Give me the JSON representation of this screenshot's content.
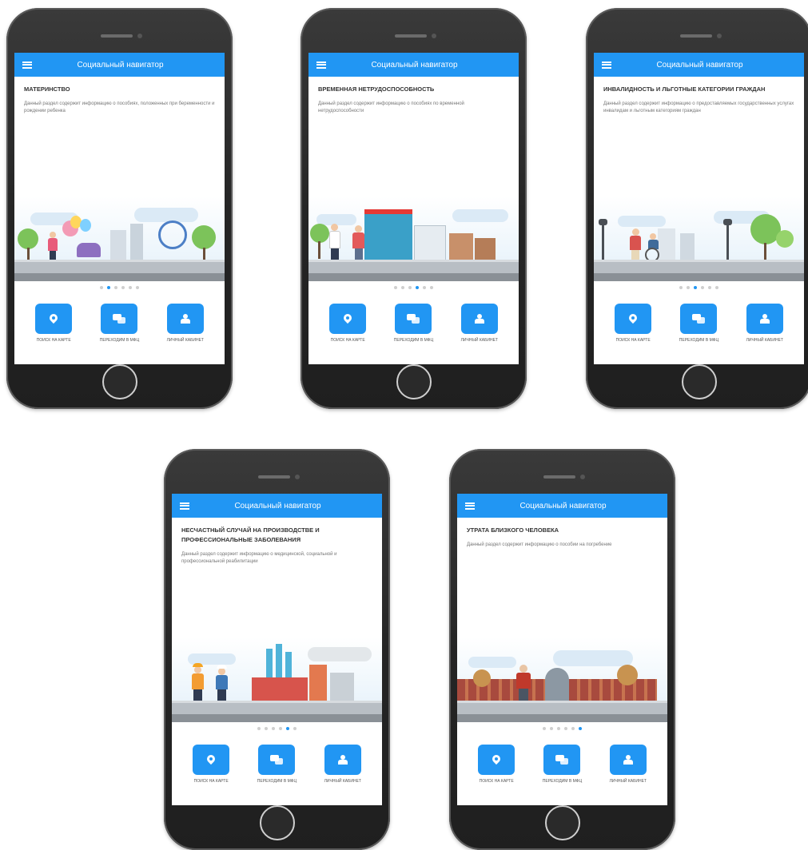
{
  "app": {
    "title": "Социальный навигатор"
  },
  "actions": [
    {
      "label": "Поиск на карте",
      "icon": "map-pin-icon"
    },
    {
      "label": "Переходим в МФЦ",
      "icon": "chat-icon"
    },
    {
      "label": "Личный кабинет",
      "icon": "user-icon"
    }
  ],
  "accent_color": "#2196f3",
  "phones": [
    {
      "title": "Материнство",
      "description": "Данный раздел содержит информацию о пособиях, положенных при беременности и рождении ребенка",
      "active_dot": 1,
      "dot_count": 6
    },
    {
      "title": "Временная нетрудоспособность",
      "description": "Данный раздел содержит информацию о пособиях по временной нетрудоспособности",
      "active_dot": 3,
      "dot_count": 6
    },
    {
      "title": "Инвалидность и льготные категории граждан",
      "description": "Данный раздел содержит информацию о предоставляемых государственных услугах инвалидам и льготным категориям граждан",
      "active_dot": 2,
      "dot_count": 6
    },
    {
      "title": "Несчастный случай на производстве и профессиональные заболевания",
      "description": "Данный раздел содержит информацию о медицинской, социальной и профессиональной реабилитации",
      "active_dot": 4,
      "dot_count": 6
    },
    {
      "title": "Утрата близкого человека",
      "description": "Данный раздел содержит информацию о пособии на погребение",
      "active_dot": 5,
      "dot_count": 6
    }
  ]
}
